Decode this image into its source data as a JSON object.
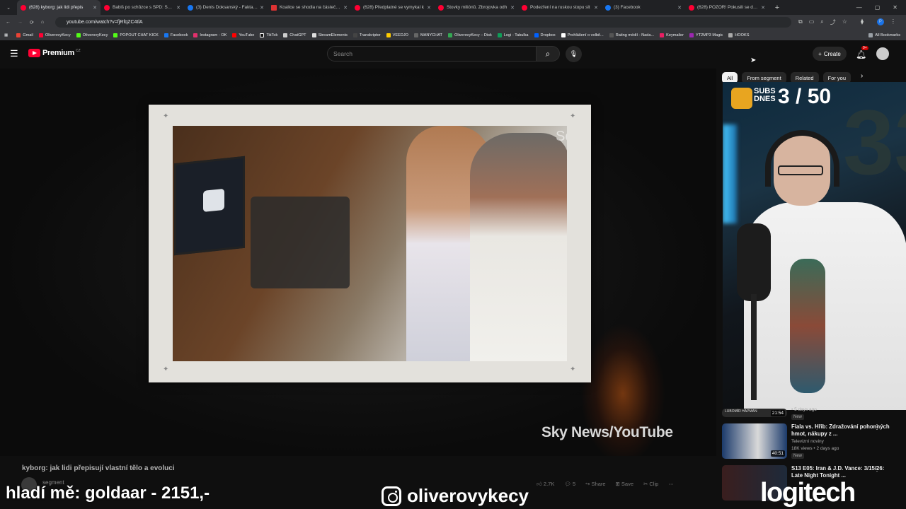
{
  "browser": {
    "tabs": [
      {
        "label": "(628) kyborg: jak lidi přepis",
        "icon": "youtube-icon",
        "active": true
      },
      {
        "label": "Babiš po schůzce s SPD: Škrtn",
        "icon": "youtube-icon"
      },
      {
        "label": "(3) Denis Doksanský - Fakta vs.",
        "icon": "facebook-icon"
      },
      {
        "label": "Koalice se shodla na částečném",
        "icon": "news-icon"
      },
      {
        "label": "(628) Předplatné se vymykal k",
        "icon": "youtube-icon"
      },
      {
        "label": "Stovky miliónů. Zbrojovka odh",
        "icon": "youtube-icon"
      },
      {
        "label": "Podezření na ruskou stopu slt",
        "icon": "youtube-icon"
      },
      {
        "label": "(3) Facebook",
        "icon": "facebook-icon"
      },
      {
        "label": "(628) POZOR! Pokusili se dostat",
        "icon": "youtube-icon"
      }
    ],
    "url": "youtube.com/watch?v=fjRfqZC4tlA",
    "bookmarks": [
      "Gmail",
      "OliverovyKecy",
      "OliverovyKecy",
      "POPOUT CHAT KICK",
      "Facebook",
      "Instagram - OK",
      "YouTube",
      "TikTok",
      "ChatGPT",
      "StreamElements",
      "Transkriptor",
      "VEEDJO",
      "MANYCHAT",
      "OliverovyKecy – Disk",
      "Logi - Tabulka",
      "Dropbox",
      "Prohlášení o volbě...",
      "Rating médií - Nada...",
      "Keymailer",
      "YT2MP3 Magic",
      "HOOKS"
    ],
    "all_bookmarks": "All Bookmarks"
  },
  "youtube": {
    "logo": "Premium",
    "region": "CZ",
    "search_placeholder": "Search",
    "create_label": "Create",
    "notifications": "9+"
  },
  "player": {
    "photo_caption_fragment": "Sc",
    "credit": "Sky News/YouTube"
  },
  "video": {
    "title": "kyborg: jak lidi přepisují vlastní tělo a evoluci",
    "channel": "segment",
    "likes": "2.7K",
    "comments": "5",
    "share": "Share",
    "save": "Save",
    "clip": "Clip"
  },
  "sidebar": {
    "chips": [
      "All",
      "From segment",
      "Related",
      "For you"
    ],
    "first_item_channel": "LUBOMÍR HAPMAN",
    "first_item_duration": "21:54",
    "first_item_meta": "• 5 days ago",
    "first_item_badge": "New",
    "items": [
      {
        "title": "Fiala vs. Hřib: Zdražování pohonných hmot, nákupy z ...",
        "channel": "Televizní noviny",
        "stats": "18K views • 2 days ago",
        "badge": "New",
        "duration": "40:51"
      },
      {
        "title": "S13 E05: Iran & J.D. Vance: 3/15/26: Late Night Tonight ...",
        "channel": "",
        "stats": "",
        "badge": "",
        "duration": ""
      }
    ]
  },
  "webcam": {
    "subs_count": "3 / 50",
    "subs_label_line1": "SUBS",
    "subs_label_line2": "DNES"
  },
  "overlay": {
    "left_text": "hladí mě: goldaar - 2151,-",
    "instagram_handle": "oliverovykecy",
    "sponsor": "logitech"
  }
}
